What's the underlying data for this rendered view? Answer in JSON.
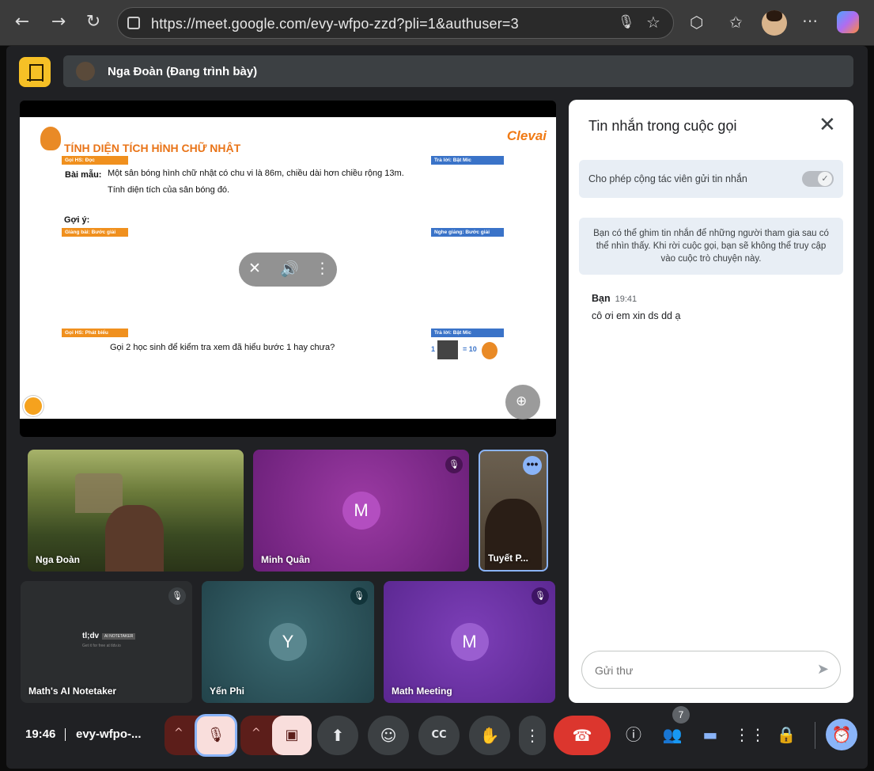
{
  "browser": {
    "url": "https://meet.google.com/evy-wfpo-zzd?pli=1&authuser=3"
  },
  "meeting": {
    "presenter_label": "Nga Đoàn (Đang trình bày)",
    "time": "19:46",
    "code": "evy-wfpo-...",
    "participant_count": "7"
  },
  "slide": {
    "title": "TÍNH DIỆN TÍCH HÌNH CHỮ NHẬT",
    "brand": "Clevai",
    "tag1": "Gọi HS: Đọc",
    "tag2": "Trả lời: Bật Mic",
    "example_label": "Bài mẫu:",
    "example_text1": "Một sân bóng hình chữ nhật có chu vi là 86m, chiều dài hơn chiều rộng 13m.",
    "example_text2": "Tính diện tích của sân bóng đó.",
    "hint_label": "Gợi ý:",
    "tag3": "Giảng bài: Bước giải",
    "tag4": "Nghe giảng: Bước giải",
    "tag5": "Gọi HS: Phát biểu",
    "tag6": "Trả lời: Bật Mic",
    "question": "Gọi 2 học sinh để kiểm tra xem đã hiểu bước 1 hay chưa?",
    "reward_left": "1",
    "reward_right": "= 10"
  },
  "participants": [
    {
      "name": "Nga Đoàn"
    },
    {
      "name": "Minh Quân",
      "letter": "M"
    },
    {
      "name": "Tuyết P..."
    },
    {
      "name": "Math's AI Notetaker",
      "logo": "tl;dv",
      "logo_badge": "AI NOTETAKER",
      "logo_sub": "Get it for free at tldv.io"
    },
    {
      "name": "Yến Phi",
      "letter": "Y"
    },
    {
      "name": "Math Meeting",
      "letter": "M"
    }
  ],
  "chat": {
    "title": "Tin nhắn trong cuộc gọi",
    "toggle_label": "Cho phép cộng tác viên gửi tin nhắn",
    "toggle_on": true,
    "info": "Bạn có thể ghim tin nhắn để những người tham gia sau có thể nhìn thấy. Khi rời cuộc gọi, bạn sẽ không thể truy cập vào cuộc trò chuyện này.",
    "messages": [
      {
        "sender": "Bạn",
        "time": "19:41",
        "text": "cô ơi em xin ds dd ạ"
      }
    ],
    "compose_placeholder": "Gửi thư"
  },
  "colors": {
    "accent_blue": "#8ab4f8",
    "hangup_red": "#dc362e",
    "brand_orange": "#f07a14"
  }
}
